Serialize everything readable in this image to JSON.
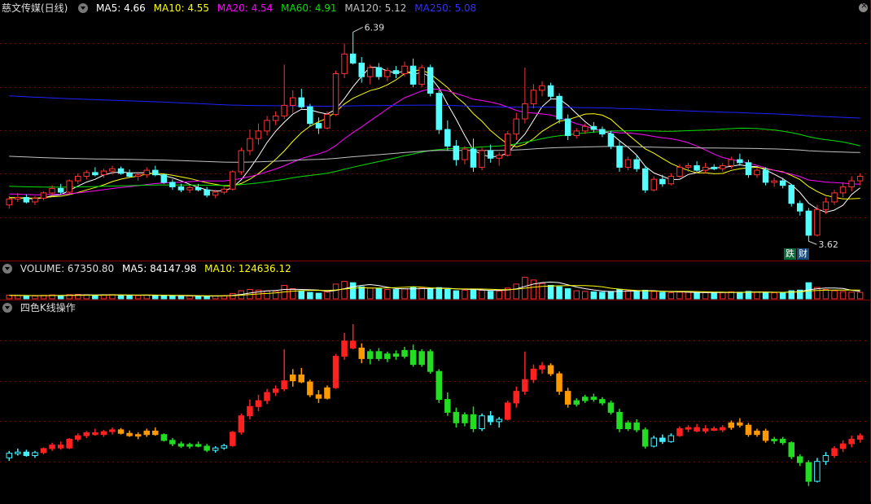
{
  "main_header": {
    "stock_name": "慈文传媒(日线)",
    "ma5": "MA5: 4.66",
    "ma10": "MA10: 4.55",
    "ma20": "MA20: 4.54",
    "ma60": "MA60: 4.91",
    "ma120": "MA120: 5.12",
    "ma250": "MA250: 5.08"
  },
  "volume_header": {
    "label": "VOLUME: 67350.80",
    "ma5": "MA5: 84147.98",
    "ma10": "MA10: 124636.12"
  },
  "indicator_header": {
    "label": "四色K线操作"
  },
  "badges": {
    "fall": "跌",
    "finance": "财"
  },
  "colors": {
    "up": "#ff3232",
    "down": "#54ffff",
    "ma5": "#ffffff",
    "ma10": "#ffff00",
    "ma20": "#ff00ff",
    "ma60": "#00e000",
    "ma120": "#c0c0c0",
    "ma250": "#2020ff",
    "four_red": "#ff2020",
    "four_orange": "#ff9900",
    "four_green": "#22dd22",
    "four_cyan": "#40f0ff"
  },
  "chart_data": {
    "type": "candlestick",
    "annotations": {
      "high": "6.39",
      "low": "3.62"
    },
    "ohlc": [
      [
        4.1,
        4.22,
        4.05,
        4.18
      ],
      [
        4.18,
        4.26,
        4.14,
        4.2
      ],
      [
        4.2,
        4.24,
        4.12,
        4.14
      ],
      [
        4.14,
        4.22,
        4.1,
        4.19
      ],
      [
        4.19,
        4.28,
        4.16,
        4.26
      ],
      [
        4.26,
        4.36,
        4.22,
        4.32
      ],
      [
        4.32,
        4.38,
        4.24,
        4.27
      ],
      [
        4.27,
        4.44,
        4.25,
        4.42
      ],
      [
        4.42,
        4.52,
        4.38,
        4.48
      ],
      [
        4.48,
        4.56,
        4.44,
        4.53
      ],
      [
        4.53,
        4.6,
        4.48,
        4.5
      ],
      [
        4.5,
        4.58,
        4.46,
        4.55
      ],
      [
        4.55,
        4.62,
        4.5,
        4.58
      ],
      [
        4.58,
        4.61,
        4.5,
        4.52
      ],
      [
        4.52,
        4.57,
        4.46,
        4.48
      ],
      [
        4.48,
        4.54,
        4.42,
        4.5
      ],
      [
        4.5,
        4.6,
        4.46,
        4.56
      ],
      [
        4.56,
        4.62,
        4.48,
        4.5
      ],
      [
        4.5,
        4.52,
        4.38,
        4.4
      ],
      [
        4.4,
        4.44,
        4.3,
        4.34
      ],
      [
        4.34,
        4.38,
        4.27,
        4.3
      ],
      [
        4.3,
        4.36,
        4.26,
        4.33
      ],
      [
        4.33,
        4.38,
        4.28,
        4.3
      ],
      [
        4.3,
        4.34,
        4.2,
        4.23
      ],
      [
        4.23,
        4.3,
        4.19,
        4.27
      ],
      [
        4.27,
        4.34,
        4.24,
        4.31
      ],
      [
        4.31,
        4.56,
        4.29,
        4.54
      ],
      [
        4.54,
        4.86,
        4.5,
        4.82
      ],
      [
        4.82,
        5.1,
        4.76,
        4.98
      ],
      [
        4.98,
        5.18,
        4.9,
        5.08
      ],
      [
        5.08,
        5.28,
        5.02,
        5.22
      ],
      [
        5.22,
        5.34,
        5.16,
        5.28
      ],
      [
        5.28,
        5.96,
        5.24,
        5.42
      ],
      [
        5.42,
        5.62,
        5.32,
        5.52
      ],
      [
        5.52,
        5.64,
        5.38,
        5.4
      ],
      [
        5.4,
        5.44,
        5.14,
        5.18
      ],
      [
        5.18,
        5.26,
        5.04,
        5.12
      ],
      [
        5.12,
        5.34,
        5.1,
        5.3
      ],
      [
        5.3,
        5.88,
        5.28,
        5.84
      ],
      [
        5.84,
        6.24,
        5.78,
        6.1
      ],
      [
        6.1,
        6.39,
        5.96,
        5.98
      ],
      [
        5.98,
        6.06,
        5.72,
        5.8
      ],
      [
        5.8,
        5.96,
        5.7,
        5.92
      ],
      [
        5.92,
        5.98,
        5.76,
        5.8
      ],
      [
        5.8,
        5.92,
        5.74,
        5.88
      ],
      [
        5.88,
        5.94,
        5.78,
        5.84
      ],
      [
        5.84,
        6.0,
        5.8,
        5.94
      ],
      [
        5.94,
        6.04,
        5.66,
        5.7
      ],
      [
        5.7,
        5.96,
        5.66,
        5.92
      ],
      [
        5.92,
        5.96,
        5.54,
        5.58
      ],
      [
        5.58,
        5.62,
        5.04,
        5.1
      ],
      [
        5.1,
        5.22,
        4.82,
        4.88
      ],
      [
        4.88,
        4.96,
        4.62,
        4.7
      ],
      [
        4.7,
        4.88,
        4.64,
        4.84
      ],
      [
        4.84,
        4.98,
        4.54,
        4.6
      ],
      [
        4.6,
        4.86,
        4.56,
        4.82
      ],
      [
        4.82,
        4.9,
        4.66,
        4.72
      ],
      [
        4.72,
        4.8,
        4.62,
        4.76
      ],
      [
        4.76,
        5.08,
        4.74,
        5.04
      ],
      [
        5.04,
        5.32,
        4.96,
        5.24
      ],
      [
        5.24,
        5.92,
        5.18,
        5.44
      ],
      [
        5.44,
        5.7,
        5.38,
        5.62
      ],
      [
        5.62,
        5.74,
        5.54,
        5.68
      ],
      [
        5.68,
        5.72,
        5.5,
        5.54
      ],
      [
        5.54,
        5.58,
        5.18,
        5.24
      ],
      [
        5.24,
        5.3,
        4.96,
        5.02
      ],
      [
        5.02,
        5.12,
        4.98,
        5.08
      ],
      [
        5.08,
        5.18,
        5.04,
        5.14
      ],
      [
        5.14,
        5.2,
        5.06,
        5.1
      ],
      [
        5.1,
        5.14,
        5.0,
        5.04
      ],
      [
        5.04,
        5.08,
        4.84,
        4.88
      ],
      [
        4.88,
        4.94,
        4.54,
        4.6
      ],
      [
        4.6,
        4.74,
        4.56,
        4.7
      ],
      [
        4.7,
        4.76,
        4.54,
        4.58
      ],
      [
        4.58,
        4.62,
        4.26,
        4.3
      ],
      [
        4.3,
        4.48,
        4.28,
        4.44
      ],
      [
        4.44,
        4.5,
        4.34,
        4.38
      ],
      [
        4.38,
        4.52,
        4.36,
        4.48
      ],
      [
        4.48,
        4.64,
        4.46,
        4.6
      ],
      [
        4.6,
        4.66,
        4.54,
        4.62
      ],
      [
        4.62,
        4.68,
        4.54,
        4.56
      ],
      [
        4.56,
        4.66,
        4.52,
        4.6
      ],
      [
        4.6,
        4.64,
        4.56,
        4.58
      ],
      [
        4.58,
        4.66,
        4.54,
        4.62
      ],
      [
        4.62,
        4.74,
        4.58,
        4.7
      ],
      [
        4.7,
        4.78,
        4.62,
        4.66
      ],
      [
        4.66,
        4.7,
        4.46,
        4.5
      ],
      [
        4.5,
        4.6,
        4.46,
        4.56
      ],
      [
        4.56,
        4.6,
        4.36,
        4.4
      ],
      [
        4.4,
        4.46,
        4.34,
        4.42
      ],
      [
        4.42,
        4.46,
        4.32,
        4.36
      ],
      [
        4.36,
        4.38,
        4.08,
        4.12
      ],
      [
        4.12,
        4.16,
        3.96,
        4.02
      ],
      [
        4.02,
        4.06,
        3.62,
        3.7
      ],
      [
        3.7,
        4.1,
        3.68,
        4.04
      ],
      [
        4.04,
        4.2,
        3.98,
        4.14
      ],
      [
        4.14,
        4.3,
        4.1,
        4.26
      ],
      [
        4.26,
        4.4,
        4.2,
        4.34
      ],
      [
        4.34,
        4.48,
        4.28,
        4.42
      ],
      [
        4.42,
        4.52,
        4.36,
        4.48
      ]
    ],
    "volume": [
      55,
      48,
      40,
      44,
      52,
      58,
      50,
      62,
      66,
      60,
      54,
      58,
      62,
      54,
      48,
      50,
      56,
      52,
      46,
      42,
      40,
      44,
      42,
      38,
      44,
      48,
      80,
      120,
      140,
      130,
      118,
      110,
      200,
      150,
      120,
      96,
      84,
      100,
      220,
      260,
      240,
      180,
      160,
      150,
      140,
      138,
      150,
      170,
      160,
      154,
      168,
      140,
      120,
      130,
      142,
      128,
      112,
      118,
      160,
      220,
      320,
      280,
      230,
      200,
      180,
      150,
      120,
      110,
      104,
      98,
      110,
      140,
      120,
      112,
      128,
      110,
      96,
      90,
      100,
      98,
      92,
      94,
      90,
      96,
      104,
      98,
      110,
      100,
      96,
      90,
      92,
      120,
      130,
      240,
      170,
      140,
      120,
      108,
      100,
      96
    ],
    "volume_ylim": [
      0,
      340
    ],
    "price_ylim": [
      3.45,
      6.6
    ],
    "indicator_colors": [
      "cyan",
      "cyan",
      "cyan",
      "cyan",
      "red",
      "red",
      "red",
      "red",
      "red",
      "red",
      "red",
      "red",
      "red",
      "orange",
      "orange",
      "orange",
      "orange",
      "orange",
      "green",
      "green",
      "green",
      "green",
      "green",
      "green",
      "cyan",
      "cyan",
      "red",
      "red",
      "red",
      "red",
      "red",
      "red",
      "red",
      "orange",
      "orange",
      "orange",
      "orange",
      "orange",
      "red",
      "red",
      "red",
      "orange",
      "green",
      "green",
      "green",
      "green",
      "green",
      "green",
      "green",
      "green",
      "green",
      "green",
      "green",
      "green",
      "green",
      "cyan",
      "cyan",
      "cyan",
      "red",
      "red",
      "red",
      "red",
      "red",
      "orange",
      "orange",
      "orange",
      "green",
      "green",
      "green",
      "green",
      "green",
      "green",
      "green",
      "green",
      "green",
      "cyan",
      "cyan",
      "cyan",
      "red",
      "red",
      "red",
      "red",
      "red",
      "red",
      "orange",
      "orange",
      "orange",
      "orange",
      "orange",
      "green",
      "green",
      "green",
      "green",
      "green",
      "cyan",
      "cyan",
      "red",
      "red",
      "red",
      "red"
    ]
  }
}
